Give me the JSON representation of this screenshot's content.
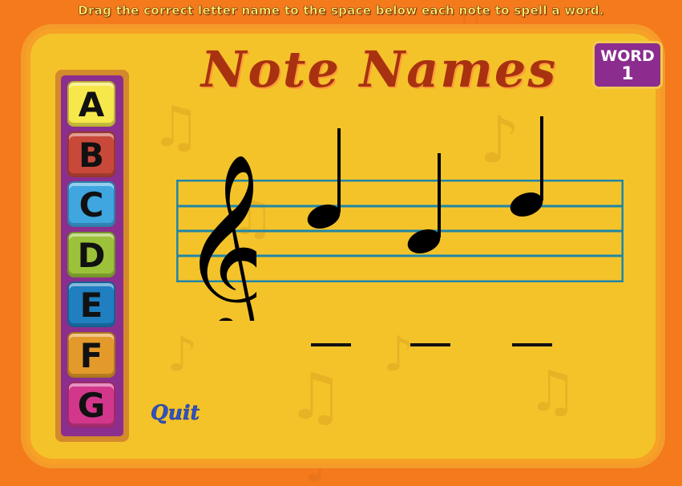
{
  "instruction": "Drag the correct letter name to the space below each note to spell a word.",
  "title": "Note Names",
  "word_badge": {
    "label": "WORD",
    "number": "1"
  },
  "letters": [
    {
      "letter": "A",
      "color": "#f6e84a"
    },
    {
      "letter": "B",
      "color": "#c8493a"
    },
    {
      "letter": "C",
      "color": "#3fa6e0"
    },
    {
      "letter": "D",
      "color": "#9cc23a"
    },
    {
      "letter": "E",
      "color": "#1f7fc0"
    },
    {
      "letter": "F",
      "color": "#e39a2a"
    },
    {
      "letter": "G",
      "color": "#d2378c"
    }
  ],
  "quit_label": "Quit",
  "colors": {
    "staff": "#1f86a8",
    "title": "#a83210",
    "panel": "#f4c32a",
    "badge": "#8b2c8e"
  }
}
